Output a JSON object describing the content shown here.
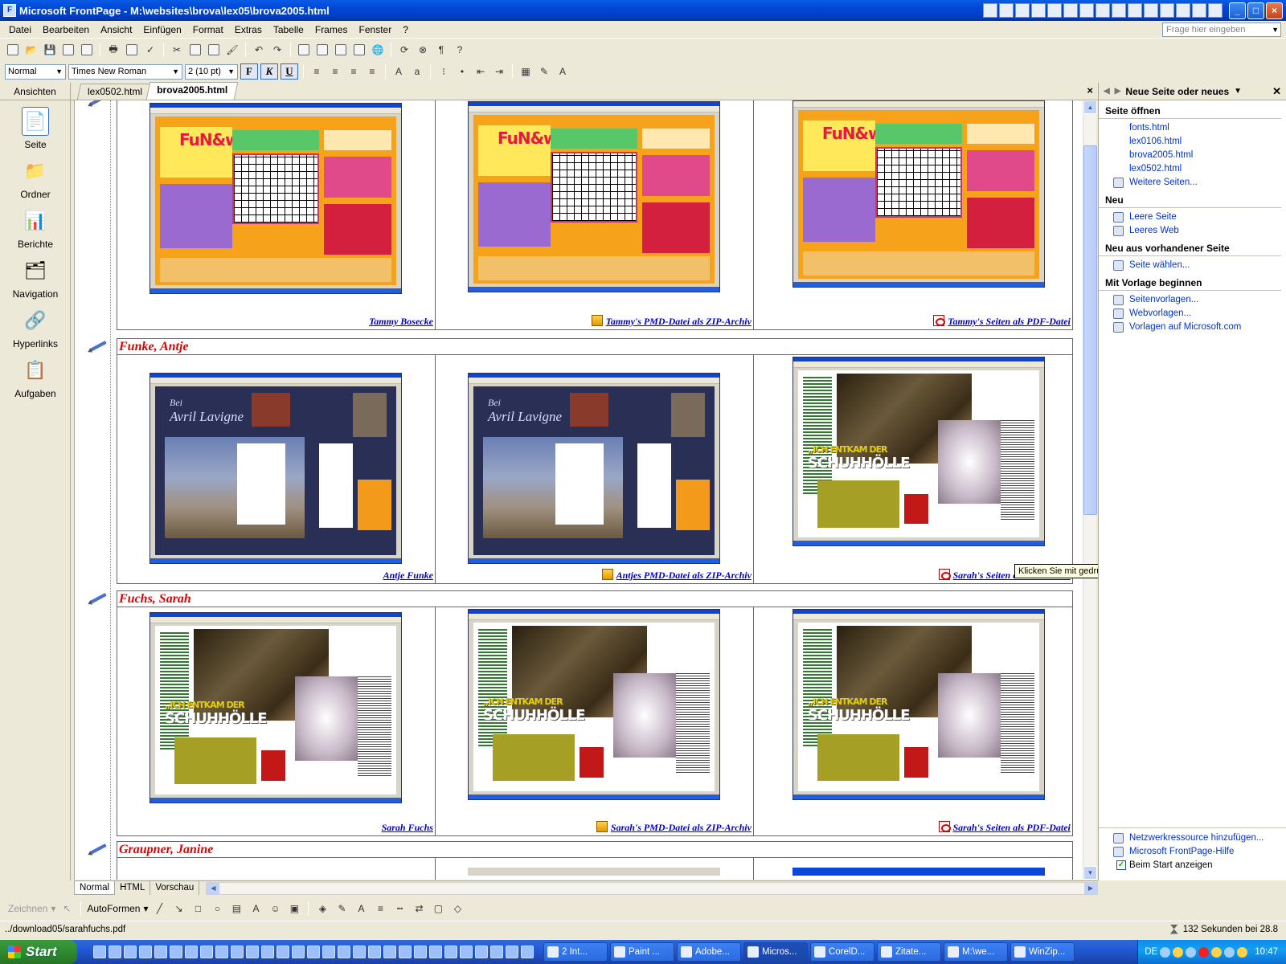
{
  "window": {
    "title": "Microsoft FrontPage - M:\\websites\\brova\\lex05\\brova2005.html",
    "minimize": "_",
    "maximize": "□",
    "close": "×"
  },
  "menu": {
    "items": [
      "Datei",
      "Bearbeiten",
      "Ansicht",
      "Einfügen",
      "Format",
      "Extras",
      "Tabelle",
      "Frames",
      "Fenster",
      "?"
    ],
    "help_box_placeholder": "Frage hier eingeben"
  },
  "format_toolbar": {
    "style": "Normal",
    "font": "Times New Roman",
    "size": "2  (10 pt)",
    "bold": "F",
    "italic": "K",
    "underline": "U"
  },
  "views_bar": {
    "header": "Ansichten",
    "items": [
      {
        "label": "Seite",
        "icon": "page-view-icon",
        "active": true
      },
      {
        "label": "Ordner",
        "icon": "folder-view-icon",
        "active": false
      },
      {
        "label": "Berichte",
        "icon": "reports-view-icon",
        "active": false
      },
      {
        "label": "Navigation",
        "icon": "navigation-view-icon",
        "active": false
      },
      {
        "label": "Hyperlinks",
        "icon": "hyperlinks-view-icon",
        "active": false
      },
      {
        "label": "Aufgaben",
        "icon": "tasks-view-icon",
        "active": false
      }
    ]
  },
  "doc_tabs": {
    "tabs": [
      "lex0502.html",
      "brova2005.html"
    ],
    "active": "brova2005.html",
    "close": "×"
  },
  "content": {
    "rows": [
      {
        "name": "",
        "thumb_style": [
          "funwin",
          "funwin",
          "funwin"
        ],
        "links": [
          {
            "text": "Tammy Bosecke",
            "icon": ""
          },
          {
            "text": "Tammy's PMD-Datei als ZIP-Archiv",
            "icon": "zip"
          },
          {
            "text": "Tammy's Seiten als PDF-Datei",
            "icon": "pdf"
          }
        ]
      },
      {
        "name": "Funke, Antje",
        "thumb_style": [
          "avril",
          "avril",
          "schuh"
        ],
        "links": [
          {
            "text": "Antje Funke",
            "icon": ""
          },
          {
            "text": "Antjes PMD-Datei als ZIP-Archiv",
            "icon": "zip"
          },
          {
            "text": "Sarah's Seiten als PDF-Datei",
            "icon": "pdf"
          }
        ]
      },
      {
        "name": "Fuchs, Sarah",
        "thumb_style": [
          "schuh",
          "schuh",
          "schuh"
        ],
        "links": [
          {
            "text": "Sarah Fuchs",
            "icon": ""
          },
          {
            "text": "Sarah's PMD-Datei als ZIP-Archiv",
            "icon": "zip"
          },
          {
            "text": "Sarah's Seiten als PDF-Datei",
            "icon": "pdf"
          }
        ]
      },
      {
        "name": "Graupner, Janine",
        "thumb_style": [],
        "links": []
      }
    ],
    "thumb_texts": {
      "funwin": "FuN&wiN!",
      "avril_title": "Avril Lavigne",
      "avril_bei": "Bei",
      "schuh_small": "„ICH ENTKAM DER",
      "schuh_big": "SCHUHHÖLLE"
    },
    "tooltip": "Klicken Sie mit gedrückter Strg-Taste, um einem Hyperlink zu folgen"
  },
  "task_pane": {
    "title": "Neue Seite oder neues",
    "sections": [
      {
        "title": "Seite öffnen",
        "links": [
          {
            "text": "fonts.html",
            "icon": false
          },
          {
            "text": "lex0106.html",
            "icon": false
          },
          {
            "text": "brova2005.html",
            "icon": false
          },
          {
            "text": "lex0502.html",
            "icon": false
          },
          {
            "text": "Weitere Seiten...",
            "icon": true
          }
        ]
      },
      {
        "title": "Neu",
        "links": [
          {
            "text": "Leere Seite",
            "icon": true
          },
          {
            "text": "Leeres Web",
            "icon": true
          }
        ]
      },
      {
        "title": "Neu aus vorhandener Seite",
        "links": [
          {
            "text": "Seite wählen...",
            "icon": true
          }
        ]
      },
      {
        "title": "Mit Vorlage beginnen",
        "links": [
          {
            "text": "Seitenvorlagen...",
            "icon": true
          },
          {
            "text": "Webvorlagen...",
            "icon": true
          },
          {
            "text": "Vorlagen auf Microsoft.com",
            "icon": true
          }
        ]
      }
    ],
    "bottom_links": [
      "Netzwerkressource hinzufügen...",
      "Microsoft FrontPage-Hilfe"
    ],
    "startup_checkbox": "Beim Start anzeigen",
    "startup_checked": true
  },
  "view_tabs": [
    "Normal",
    "HTML",
    "Vorschau"
  ],
  "draw_toolbar": {
    "zeichnen": "Zeichnen",
    "autoformen": "AutoFormen"
  },
  "status": {
    "left": "../download05/sarahfuchs.pdf",
    "right": "132 Sekunden bei 28.8"
  },
  "taskbar": {
    "start": "Start",
    "tasks": [
      "2 Int...",
      "Paint ...",
      "Adobe...",
      "Micros...",
      "CorelD...",
      "Zitate...",
      "M:\\we...",
      "WinZip..."
    ],
    "active_task": "Micros...",
    "lang": "DE",
    "clock": "10:47"
  }
}
